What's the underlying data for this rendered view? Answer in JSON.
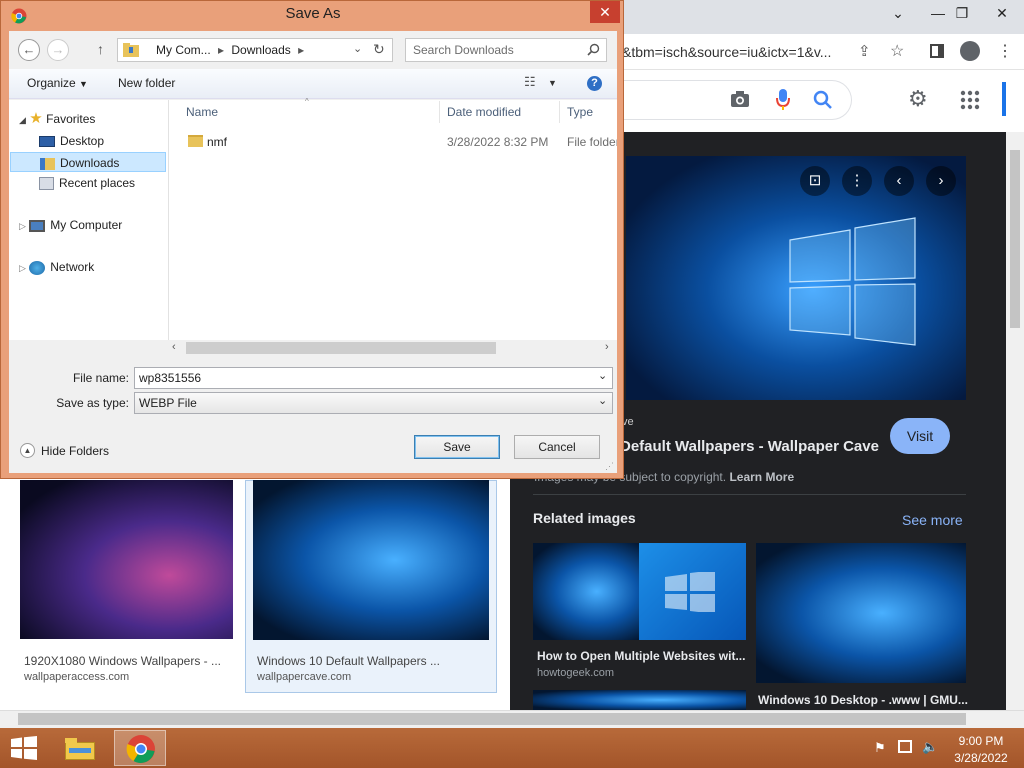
{
  "browser": {
    "url_fragment": "&tbm=isch&source=iu&ictx=1&v...",
    "controls": {
      "minimize": "⌄",
      "min": "—",
      "restore": "❐",
      "close": "✕"
    }
  },
  "detail_panel": {
    "source_label": "ve",
    "title": "Default Wallpapers - Wallpaper Cave",
    "visit_label": "Visit",
    "copyright_text": "Images may be subject to copyright.",
    "learn_more": "Learn More",
    "related_title": "Related images",
    "see_more": "See more",
    "related": [
      {
        "caption": "How to Open Multiple Websites wit...",
        "source": "howtogeek.com"
      },
      {
        "caption": "Windows 10 Desktop - .www | GMU...",
        "source": ""
      }
    ]
  },
  "results": [
    {
      "caption": "1920X1080 Windows Wallpapers - ...",
      "source": "wallpaperaccess.com"
    },
    {
      "caption": "Windows 10 Default Wallpapers ...",
      "source": "wallpapercave.com"
    }
  ],
  "dialog": {
    "title": "Save As",
    "breadcrumb": [
      "My Com...",
      "Downloads"
    ],
    "search_placeholder": "Search Downloads",
    "organize": "Organize",
    "new_folder": "New folder",
    "nav": {
      "favorites": "Favorites",
      "desktop": "Desktop",
      "downloads": "Downloads",
      "recent": "Recent places",
      "computer": "My Computer",
      "network": "Network"
    },
    "columns": {
      "name": "Name",
      "date": "Date modified",
      "type": "Type"
    },
    "files": [
      {
        "name": "nmf",
        "date": "3/28/2022 8:32 PM",
        "type": "File folder"
      }
    ],
    "file_name_label": "File name:",
    "file_name_value": "wp8351556",
    "save_type_label": "Save as type:",
    "save_type_value": "WEBP File",
    "hide_folders": "Hide Folders",
    "save": "Save",
    "cancel": "Cancel"
  },
  "taskbar": {
    "time": "9:00 PM",
    "date": "3/28/2022"
  }
}
